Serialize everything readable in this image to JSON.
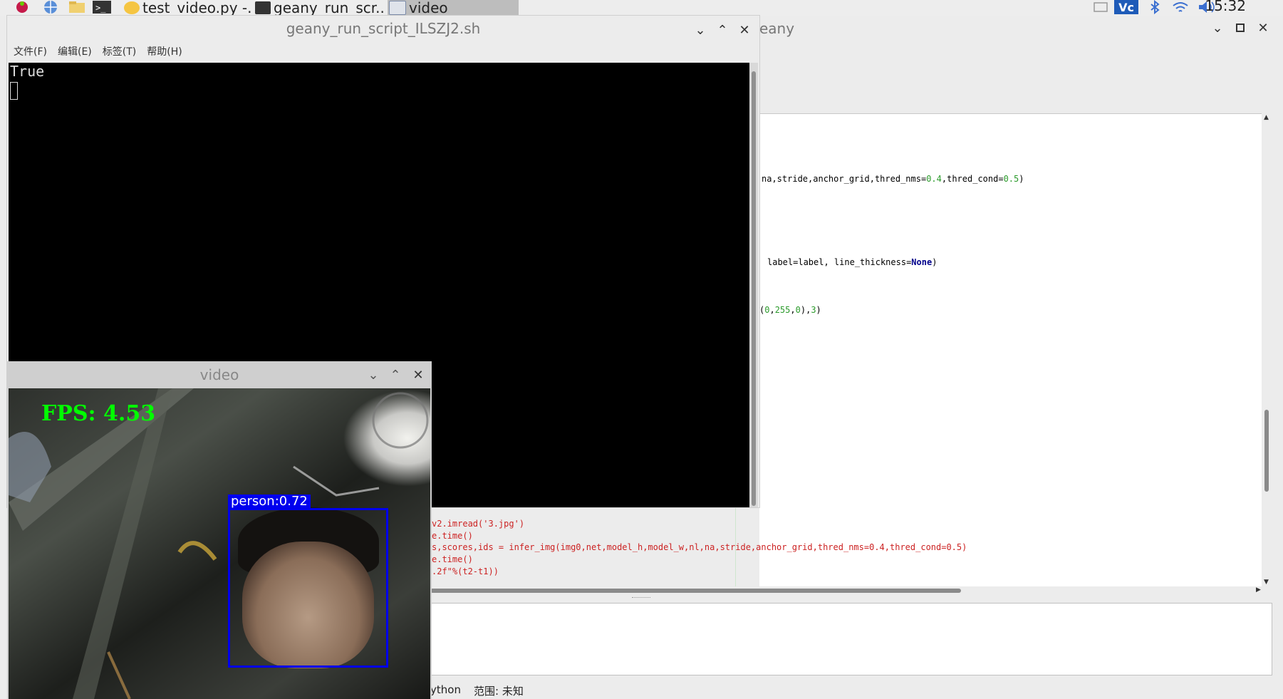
{
  "taskbar": {
    "tasks": [
      {
        "label": "test_video.py -..."
      },
      {
        "label": "geany_run_scr..."
      },
      {
        "label": "video"
      }
    ],
    "clock": "15:32"
  },
  "geany": {
    "title": "eany",
    "code_lines": {
      "l1": "na,stride,anchor_grid,thred_nms=",
      "l1n1": "0.4",
      "l1b": ",thred_cond=",
      "l1n2": "0.5",
      "l1c": ")",
      "l2": "label=label, line_thickness=",
      "l2kw": "None",
      "l2c": ")",
      "l3a": "(",
      "l3n1": "0",
      "l3b": ",",
      "l3n2": "255",
      "l3c": ",",
      "l3n3": "0",
      "l3d": "),",
      "l3n4": "3",
      "l3e": ")",
      "red1": "v2.imread('3.jpg')",
      "red2": "e.time()",
      "red3": "s,scores,ids = infer_img(img0,net,model_h,model_w,nl,na,stride,anchor_grid,thred_nms=0.4,thred_cond=0.5)",
      "red4": "e.time()",
      "red5": ".2f\"%(t2-t1))"
    },
    "status": {
      "filetype": "ython",
      "scope": "范围: 未知"
    }
  },
  "terminal": {
    "title": "geany_run_script_ILSZJ2.sh",
    "menu": [
      "文件(F)",
      "编辑(E)",
      "标签(T)",
      "帮助(H)"
    ],
    "output": "True"
  },
  "video_window": {
    "title": "video",
    "fps_label": "FPS: 4.53",
    "detection_label": "person:0.72"
  },
  "colors": {
    "fps_text": "#00ff00",
    "bbox": "#0000ee",
    "code_number": "#2a9a2a",
    "code_red": "#cc2222"
  }
}
